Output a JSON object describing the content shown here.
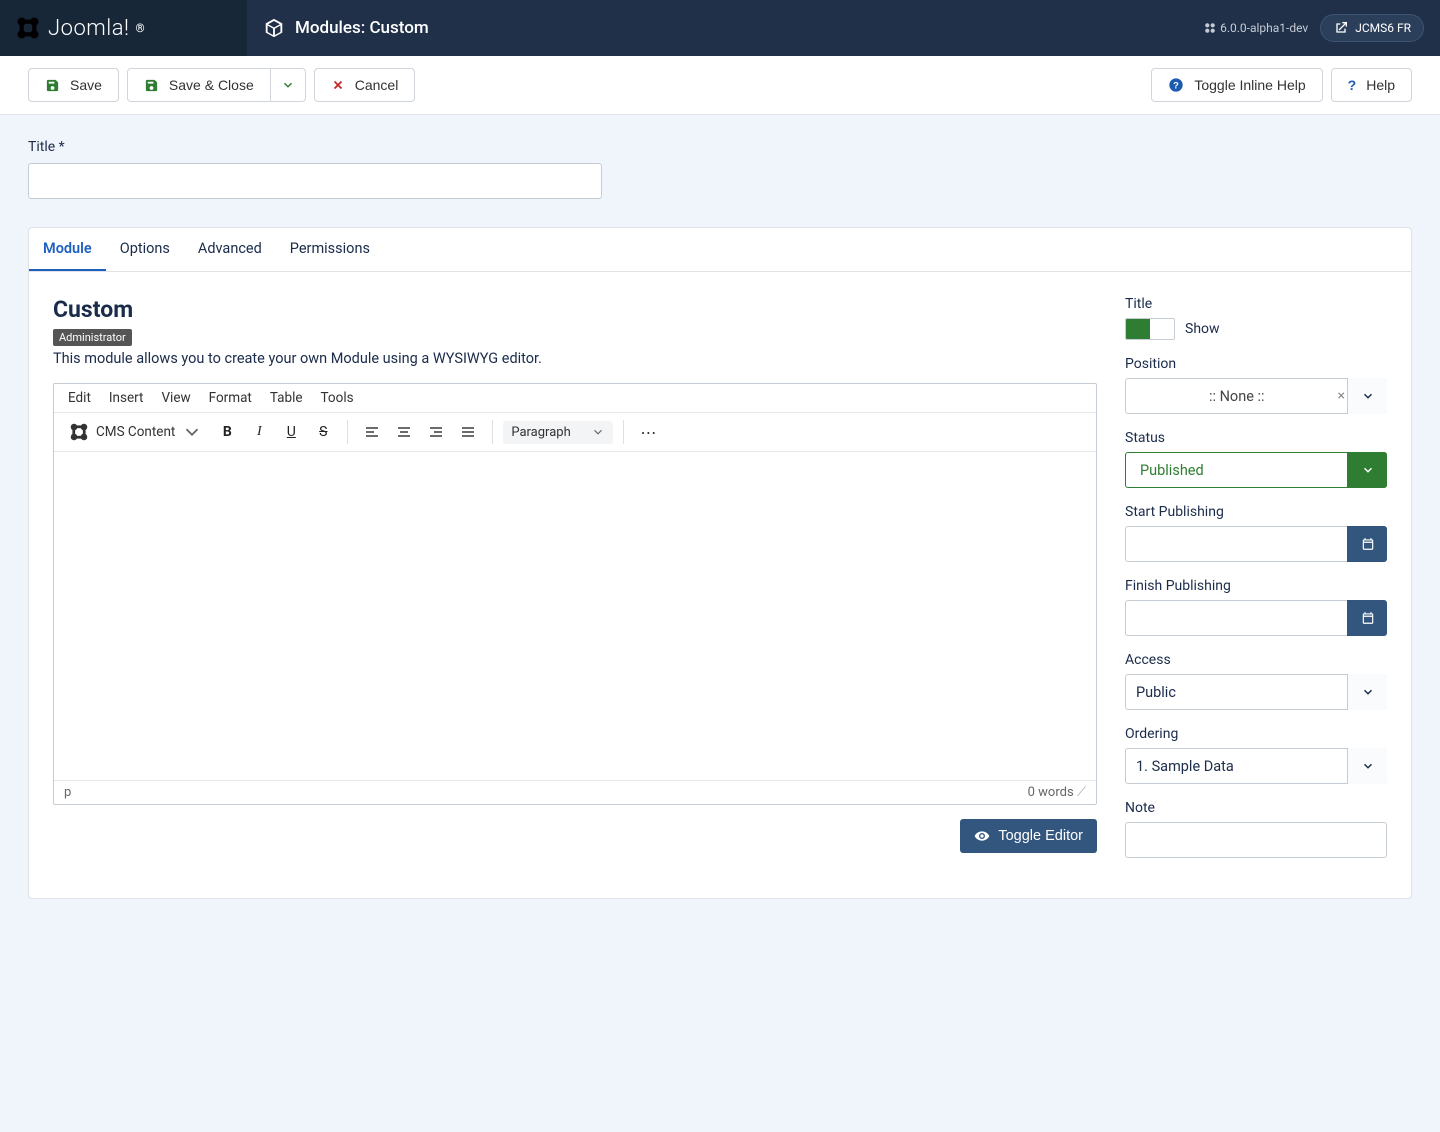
{
  "brand": {
    "name": "Joomla!"
  },
  "header": {
    "breadcrumb": "Modules: Custom",
    "version": "6.0.0-alpha1-dev",
    "target": "JCMS6 FR"
  },
  "toolbar": {
    "save": "Save",
    "save_close": "Save & Close",
    "cancel": "Cancel",
    "toggle_inline_help": "Toggle Inline Help",
    "help": "Help"
  },
  "form": {
    "title_label": "Title *"
  },
  "tabs": {
    "module": "Module",
    "options": "Options",
    "advanced": "Advanced",
    "permissions": "Permissions"
  },
  "module": {
    "heading": "Custom",
    "badge": "Administrator",
    "desc": "This module allows you to create your own Module using a WYSIWYG editor."
  },
  "editor": {
    "menus": {
      "edit": "Edit",
      "insert": "Insert",
      "view": "View",
      "format": "Format",
      "table": "Table",
      "tools": "Tools"
    },
    "cms_content": "CMS Content",
    "block_format": "Paragraph",
    "status_path": "p",
    "word_count": "0 words",
    "toggle_editor": "Toggle Editor"
  },
  "side": {
    "title_label": "Title",
    "show_label": "Show",
    "position_label": "Position",
    "position_value": ":: None ::",
    "status_label": "Status",
    "status_value": "Published",
    "start_pub_label": "Start Publishing",
    "finish_pub_label": "Finish Publishing",
    "access_label": "Access",
    "access_value": "Public",
    "ordering_label": "Ordering",
    "ordering_value": "1. Sample Data",
    "note_label": "Note"
  }
}
